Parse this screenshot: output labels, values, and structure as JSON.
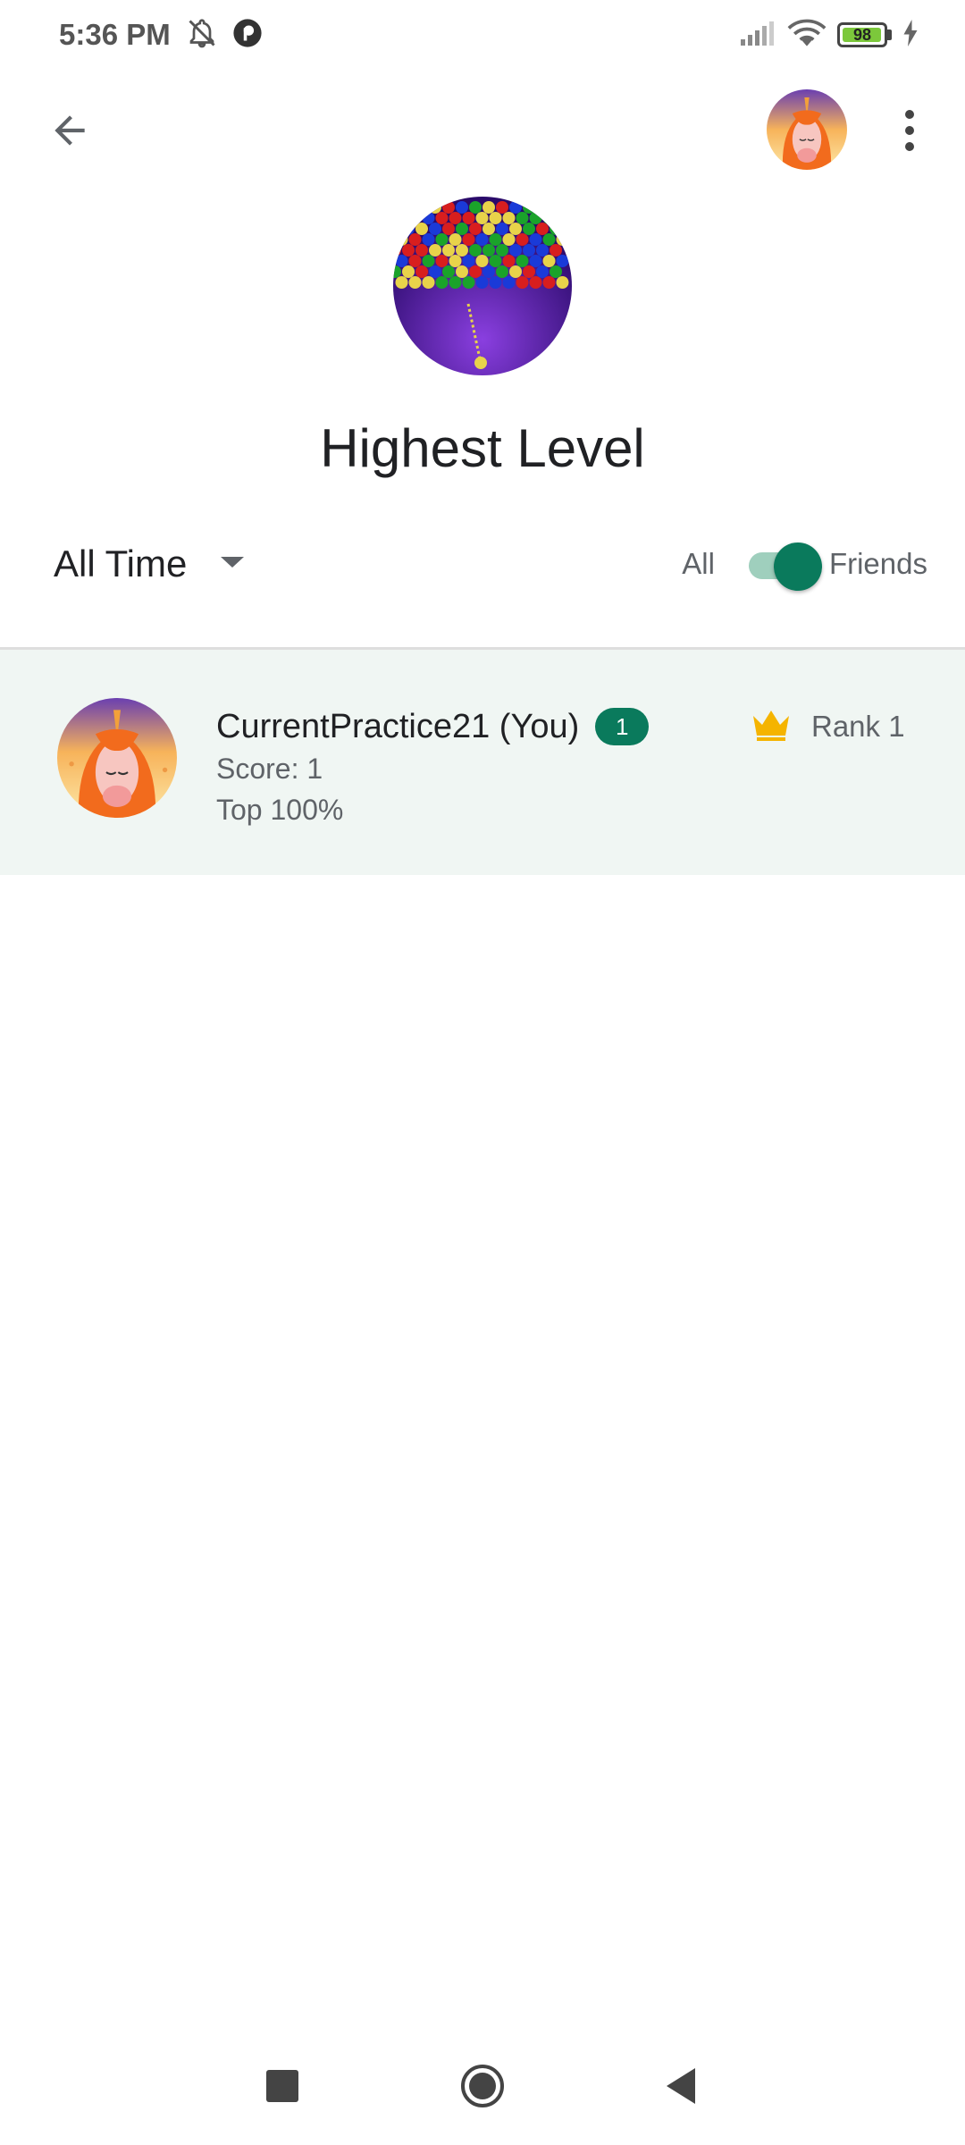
{
  "status_bar": {
    "time": "5:36 PM",
    "battery_level": "98",
    "battery_fraction": 0.98,
    "icons": [
      "bell-off-icon",
      "app-notification-icon",
      "signal-icon",
      "wifi-icon",
      "battery-icon",
      "charging-icon"
    ]
  },
  "app_bar": {
    "back_icon": "arrow-back-icon",
    "profile_icon": "unicorn-avatar",
    "menu_icon": "more-vert-icon"
  },
  "leaderboard": {
    "title": "Highest Level",
    "time_filter": "All Time",
    "toggle": {
      "left_label": "All",
      "right_label": "Friends",
      "state": "Friends"
    },
    "entries": [
      {
        "name": "CurrentPractice21 (You)",
        "level_badge": "1",
        "score": "Score: 1",
        "top_percent": "Top 100%",
        "rank": "Rank 1"
      }
    ]
  },
  "colors": {
    "accent": "#0a7a5c",
    "row_highlight": "#f0f6f3",
    "crown": "#f5b400"
  },
  "nav_bar": {
    "icons": [
      "recents-square-icon",
      "home-circle-icon",
      "back-triangle-icon"
    ]
  }
}
